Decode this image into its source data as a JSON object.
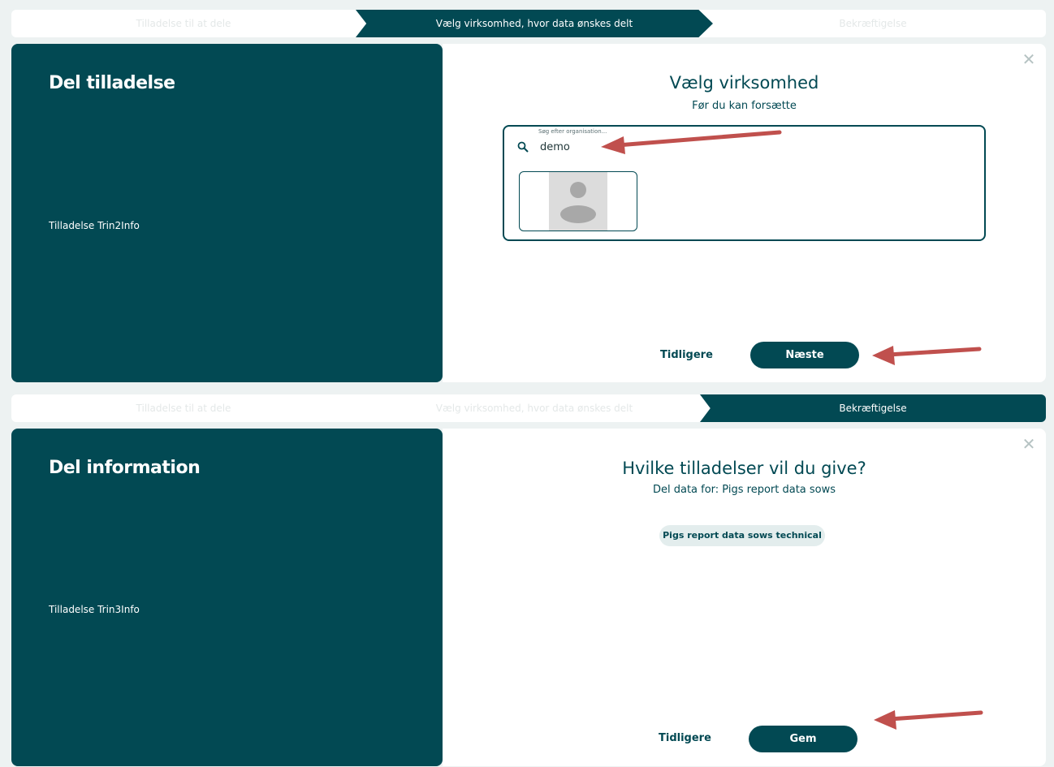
{
  "panel1": {
    "steps": [
      "Tilladelse til at dele",
      "Vælg virksomhed, hvor data ønskes delt",
      "Bekræftigelse"
    ],
    "left": {
      "title": "Del tilladelse",
      "info": "Tilladelse Trin2Info"
    },
    "right": {
      "title": "Vælg virksomhed",
      "subtitle": "Før du kan forsætte",
      "search": {
        "label": "Søg efter organisation...",
        "value": "demo"
      },
      "prev_label": "Tidligere",
      "next_label": "Næste"
    }
  },
  "panel2": {
    "steps": [
      "Tilladelse til at dele",
      "Vælg virksomhed, hvor data ønskes delt",
      "Bekræftigelse"
    ],
    "left": {
      "title": "Del information",
      "info": "Tilladelse Trin3Info"
    },
    "right": {
      "title": "Hvilke tilladelser vil du give?",
      "subtitle": "Del data for: Pigs report data sows",
      "chip": "Pigs report data sows technical",
      "prev_label": "Tidligere",
      "save_label": "Gem"
    }
  },
  "colors": {
    "primary": "#024953",
    "background": "#edf2f2",
    "arrow": "#c0504d"
  },
  "icons": [
    "close-icon",
    "search-icon",
    "avatar-placeholder-icon",
    "annotation-arrow"
  ]
}
